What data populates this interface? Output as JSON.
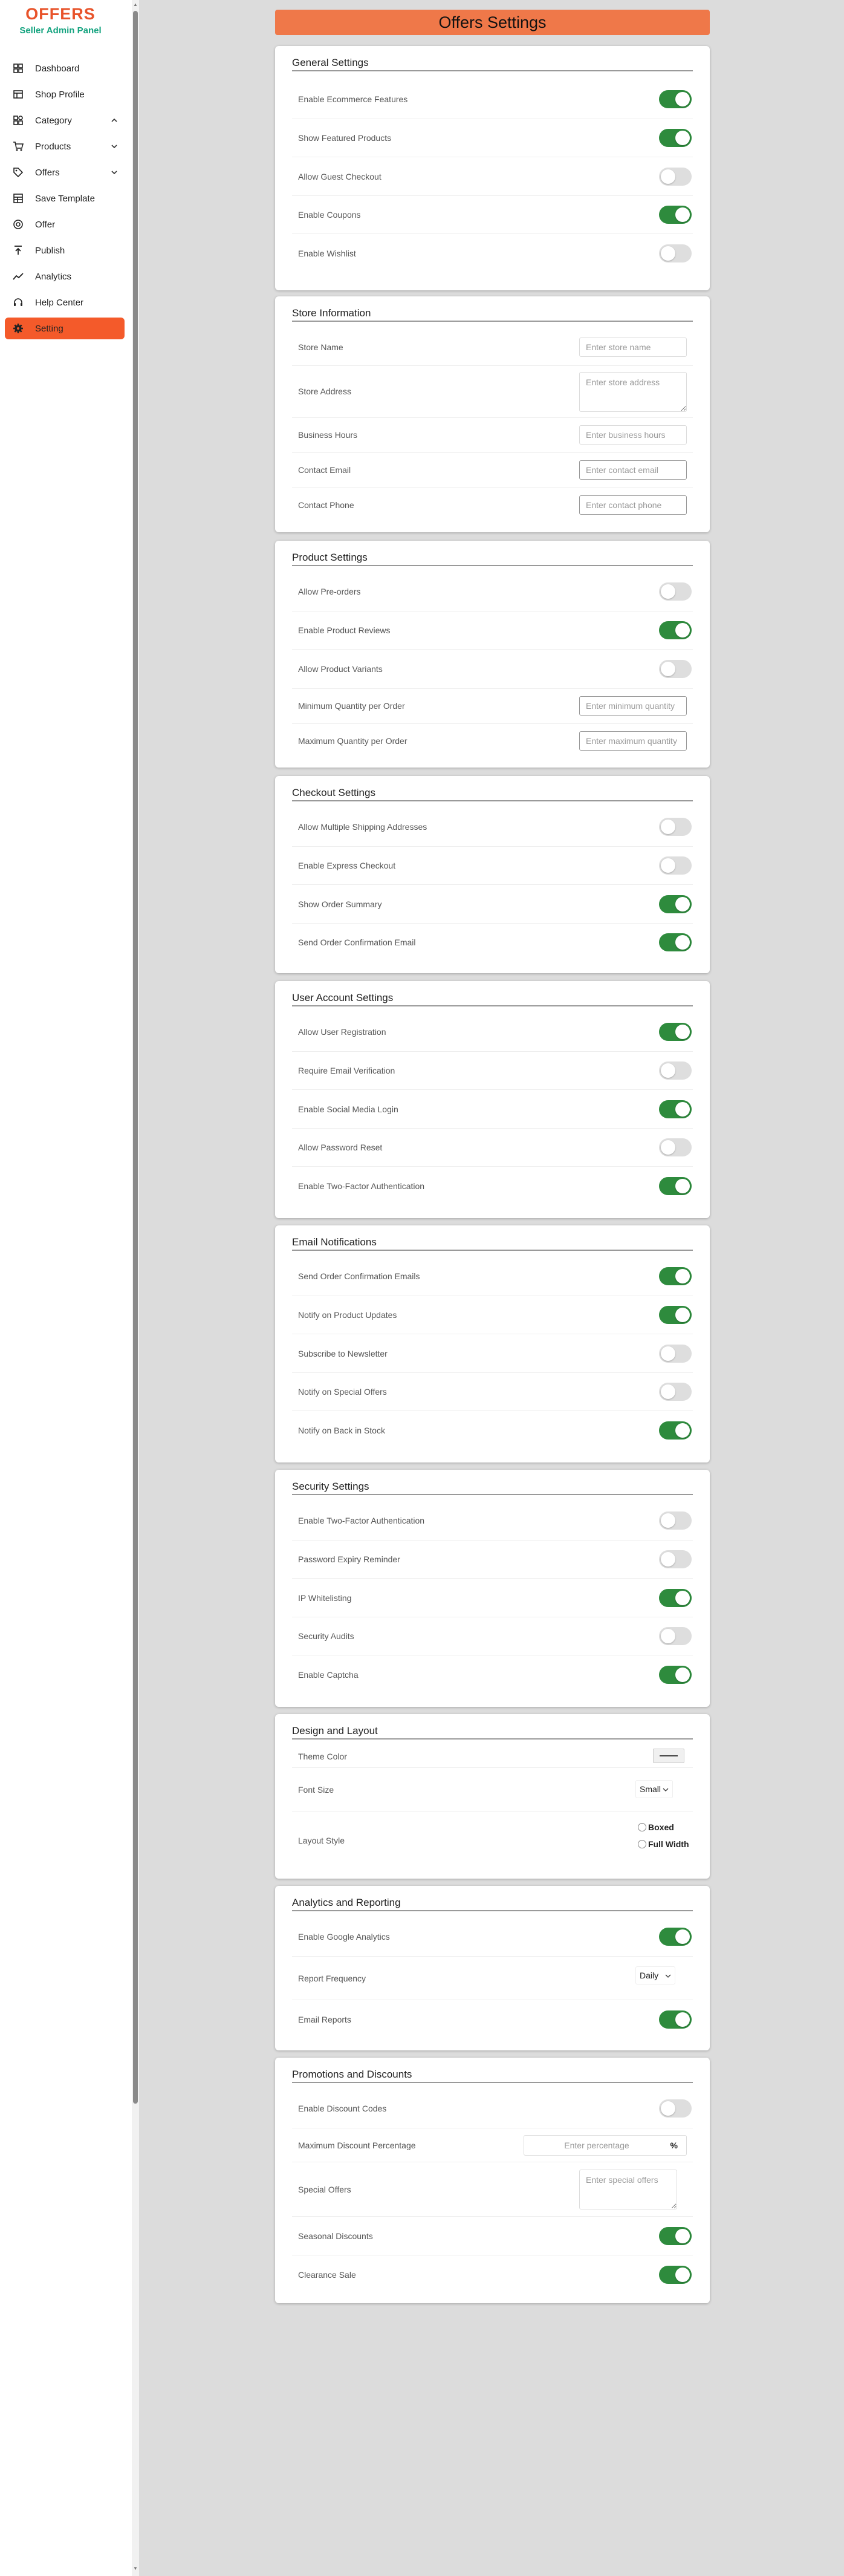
{
  "brand": {
    "logo": "OFFERS",
    "subtitle": "Seller Admin Panel",
    "accent": "#f45a2a",
    "sub_color": "#14a37f"
  },
  "sidebar": {
    "items": [
      {
        "label": "Dashboard",
        "icon": "dashboard-icon"
      },
      {
        "label": "Shop Profile",
        "icon": "store-icon"
      },
      {
        "label": "Category",
        "icon": "category-icon",
        "chevron": "up"
      },
      {
        "label": "Products",
        "icon": "cart-icon",
        "chevron": "down"
      },
      {
        "label": "Offers",
        "icon": "tag-icon",
        "chevron": "down"
      },
      {
        "label": "Save Template",
        "icon": "template-icon"
      },
      {
        "label": "Offer",
        "icon": "target-icon"
      },
      {
        "label": "Publish",
        "icon": "upload-icon"
      },
      {
        "label": "Analytics",
        "icon": "chart-line-icon"
      },
      {
        "label": "Help Center",
        "icon": "headset-icon"
      },
      {
        "label": "Setting",
        "icon": "gear-icon",
        "active": true
      }
    ]
  },
  "header": {
    "title": "Offers Settings"
  },
  "sections": {
    "general": {
      "title": "General Settings",
      "rows": [
        {
          "label": "Enable Ecommerce Features",
          "on": true
        },
        {
          "label": "Show Featured Products",
          "on": true
        },
        {
          "label": "Allow Guest Checkout",
          "on": false
        },
        {
          "label": "Enable Coupons",
          "on": true
        },
        {
          "label": "Enable Wishlist",
          "on": false
        }
      ]
    },
    "store": {
      "title": "Store Information",
      "name_label": "Store Name",
      "name_placeholder": "Enter store name",
      "address_label": "Store Address",
      "address_placeholder": "Enter store address",
      "hours_label": "Business Hours",
      "hours_placeholder": "Enter business hours",
      "email_label": "Contact Email",
      "email_placeholder": "Enter contact email",
      "phone_label": "Contact Phone",
      "phone_placeholder": "Enter contact phone"
    },
    "product": {
      "title": "Product Settings",
      "rows": [
        {
          "label": "Allow Pre-orders",
          "on": false
        },
        {
          "label": "Enable Product Reviews",
          "on": true
        },
        {
          "label": "Allow Product Variants",
          "on": false
        }
      ],
      "min_label": "Minimum Quantity per Order",
      "min_placeholder": "Enter minimum quantity",
      "max_label": "Maximum Quantity per Order",
      "max_placeholder": "Enter maximum quantity"
    },
    "checkout": {
      "title": "Checkout Settings",
      "rows": [
        {
          "label": "Allow Multiple Shipping Addresses",
          "on": false
        },
        {
          "label": "Enable Express Checkout",
          "on": false
        },
        {
          "label": "Show Order Summary",
          "on": true
        },
        {
          "label": "Send Order Confirmation Email",
          "on": true
        }
      ]
    },
    "account": {
      "title": "User Account Settings",
      "rows": [
        {
          "label": "Allow User Registration",
          "on": true
        },
        {
          "label": "Require Email Verification",
          "on": false
        },
        {
          "label": "Enable Social Media Login",
          "on": true
        },
        {
          "label": "Allow Password Reset",
          "on": false
        },
        {
          "label": "Enable Two-Factor Authentication",
          "on": true
        }
      ]
    },
    "email": {
      "title": "Email Notifications",
      "rows": [
        {
          "label": "Send Order Confirmation Emails",
          "on": true
        },
        {
          "label": "Notify on Product Updates",
          "on": true
        },
        {
          "label": "Subscribe to Newsletter",
          "on": false
        },
        {
          "label": "Notify on Special Offers",
          "on": false
        },
        {
          "label": "Notify on Back in Stock",
          "on": true
        }
      ]
    },
    "security": {
      "title": "Security Settings",
      "rows": [
        {
          "label": "Enable Two-Factor Authentication",
          "on": false
        },
        {
          "label": "Password Expiry Reminder",
          "on": false
        },
        {
          "label": "IP Whitelisting",
          "on": true
        },
        {
          "label": "Security Audits",
          "on": false
        },
        {
          "label": "Enable Captcha",
          "on": true
        }
      ]
    },
    "design": {
      "title": "Design and Layout",
      "theme_label": "Theme Color",
      "font_label": "Font Size",
      "font_value": "Small",
      "layout_label": "Layout Style",
      "layout_opt1": "Boxed",
      "layout_opt2": "Full Width"
    },
    "analytics": {
      "title": "Analytics and Reporting",
      "ga_label": "Enable Google Analytics",
      "ga_on": true,
      "freq_label": "Report Frequency",
      "freq_value": "Daily",
      "email_label": "Email Reports",
      "email_on": true
    },
    "promotions": {
      "title": "Promotions and Discounts",
      "codes_label": "Enable Discount Codes",
      "codes_on": false,
      "max_label": "Maximum Discount Percentage",
      "max_placeholder": "Enter percentage",
      "pct_symbol": "%",
      "special_label": "Special Offers",
      "special_placeholder": "Enter special offers",
      "seasonal_label": "Seasonal Discounts",
      "seasonal_on": true,
      "clearance_label": "Clearance Sale",
      "clearance_on": true
    }
  },
  "colors": {
    "toggle_on": "#2e8b3d",
    "toggle_off": "#dedede",
    "header_bg": "#ef7849",
    "page_bg": "#dcdcdc"
  }
}
